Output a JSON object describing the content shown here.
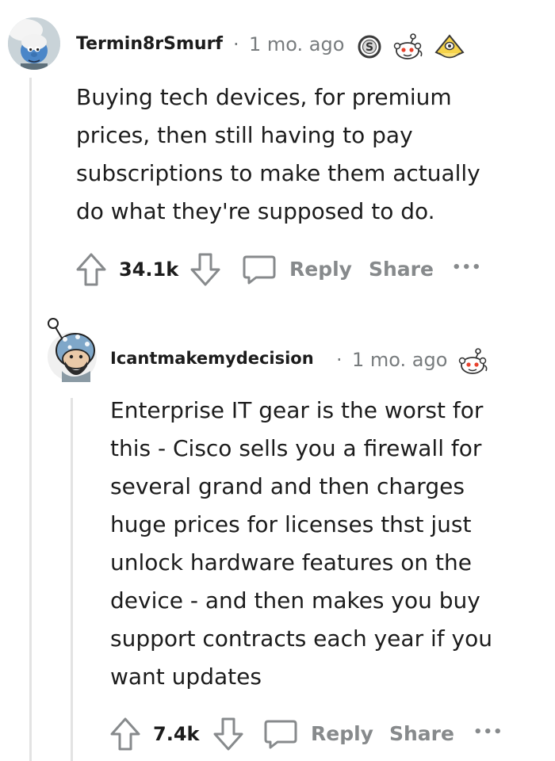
{
  "comments": [
    {
      "username": "Termin8rSmurf",
      "separator": "·",
      "time": "1 mo. ago",
      "award_icons": [
        "silver-award-icon",
        "wholesome-award-icon",
        "helpful-award-icon"
      ],
      "body_lines": [
        "Buying tech devices, for premium",
        "prices, then still having to pay",
        "subscriptions to make them actually",
        "do what they're supposed to do."
      ],
      "score": "34.1k",
      "reply_label": "Reply",
      "share_label": "Share",
      "more_label": "•••"
    },
    {
      "username": "Icantmakemydecision",
      "separator": "·",
      "time": "1 mo. ago",
      "award_icons": [
        "wholesome-award-icon"
      ],
      "body_lines": [
        "Enterprise IT gear is the worst for",
        "this - Cisco sells you a firewall for",
        "several grand and then charges",
        "huge prices for licenses thst just",
        "unlock hardware features on the",
        "device - and then makes you buy",
        "support contracts each year if you",
        "want updates"
      ],
      "score": "7.4k",
      "reply_label": "Reply",
      "share_label": "Share",
      "more_label": "•••"
    }
  ]
}
